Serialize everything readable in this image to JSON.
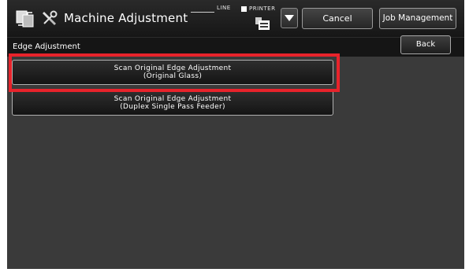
{
  "header": {
    "title": "Machine Adjustment",
    "line_label": "LINE",
    "printer_label": "PRINTER",
    "mode_icon": "copy-mode-icon",
    "tool_icon": "adjustment-tools-icon",
    "printer_icon": "printer-icon",
    "dropdown_icon": "triangle-down-icon",
    "cancel_label": "Cancel",
    "job_management_label": "Job Management"
  },
  "subheader": {
    "title": "Edge Adjustment",
    "back_label": "Back"
  },
  "options": [
    {
      "line1": "Scan Original Edge Adjustment",
      "line2": "(Original Glass)",
      "highlighted": true
    },
    {
      "line1": "Scan Original Edge Adjustment",
      "line2": "(Duplex Single Pass Feeder)",
      "highlighted": false
    }
  ],
  "colors": {
    "highlight": "#e8232b",
    "background": "#3a3a3a",
    "topbar": "#1e1e1e"
  }
}
